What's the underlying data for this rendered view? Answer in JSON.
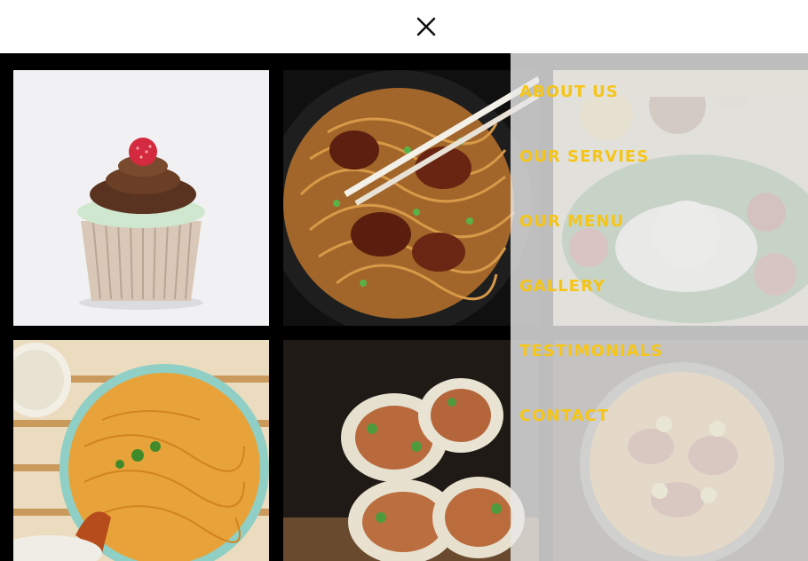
{
  "header": {
    "close_icon": "close-icon"
  },
  "gallery": {
    "images": [
      {
        "subject": "cupcake"
      },
      {
        "subject": "noodles-with-chicken"
      },
      {
        "subject": "rice-platter"
      },
      {
        "subject": "biryani"
      },
      {
        "subject": "wraps"
      },
      {
        "subject": "biryani-bowl"
      }
    ]
  },
  "menu": {
    "items": [
      {
        "label": "ABOUT US"
      },
      {
        "label": "OUR SERVIES"
      },
      {
        "label": "OUR MENU"
      },
      {
        "label": "GALLERY"
      },
      {
        "label": "TESTIMONIALS"
      },
      {
        "label": "CONTACT"
      }
    ],
    "color": "#f5c518"
  }
}
